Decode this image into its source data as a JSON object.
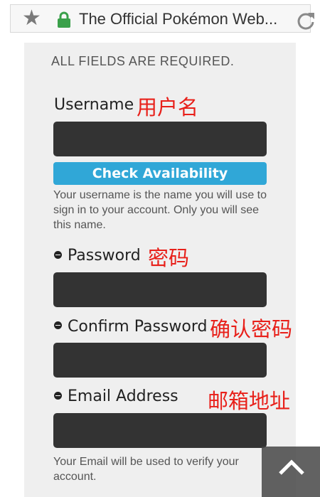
{
  "browser": {
    "page_title": "The Official Pokémon Web...",
    "bookmark_icon": "star-icon",
    "secure_icon": "lock-icon",
    "reload_icon": "reload-icon"
  },
  "form": {
    "required_note": "ALL FIELDS ARE REQUIRED.",
    "username": {
      "label": "Username",
      "annotation": "用户名",
      "value": "",
      "check_button": "Check Availability",
      "help": "Your username is the name you will use to sign in to your account. Only you will see this name."
    },
    "password": {
      "label": "Password",
      "annotation": "密码",
      "value": ""
    },
    "confirm_password": {
      "label": "Confirm Password",
      "annotation": "确认密码",
      "value": ""
    },
    "email": {
      "label": "Email Address",
      "annotation": "邮箱地址",
      "value": "",
      "help": "Your Email will be used to verify your account."
    }
  },
  "colors": {
    "accent": "#30a7d7",
    "annotation": "#e8201a",
    "input_bg": "#333333",
    "panel_bg": "#efefef"
  },
  "watermark": {
    "icon": "chevron-up-icon"
  }
}
